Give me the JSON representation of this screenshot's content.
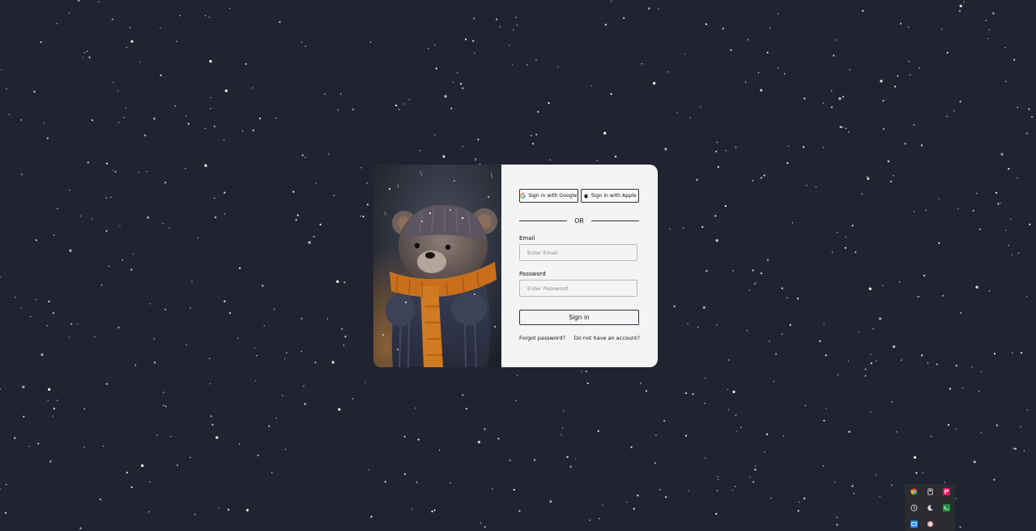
{
  "login": {
    "google_label": "Sign in with Google",
    "apple_label": "Sign in with Apple",
    "divider_text": "OR",
    "email_label": "Email",
    "email_placeholder": "Enter Email",
    "email_value": "",
    "password_label": "Password",
    "password_placeholder": "Enter Password",
    "password_value": "",
    "submit_label": "Sign in",
    "forgot_label": "Forgot password?",
    "register_label": "Do not have an account?"
  },
  "image": {
    "subject": "knitted teddy bear wearing an orange scarf in falling snow"
  },
  "tray": {
    "icons": [
      "chrome-icon",
      "usb-drive-icon",
      "app-red-icon",
      "clock-icon",
      "moon-icon",
      "terminal-icon",
      "network-icon",
      "settings-icon"
    ]
  },
  "colors": {
    "background": "#222331",
    "card": "#f4f4f4",
    "scarf": "#c96f1c",
    "text": "#111111"
  }
}
